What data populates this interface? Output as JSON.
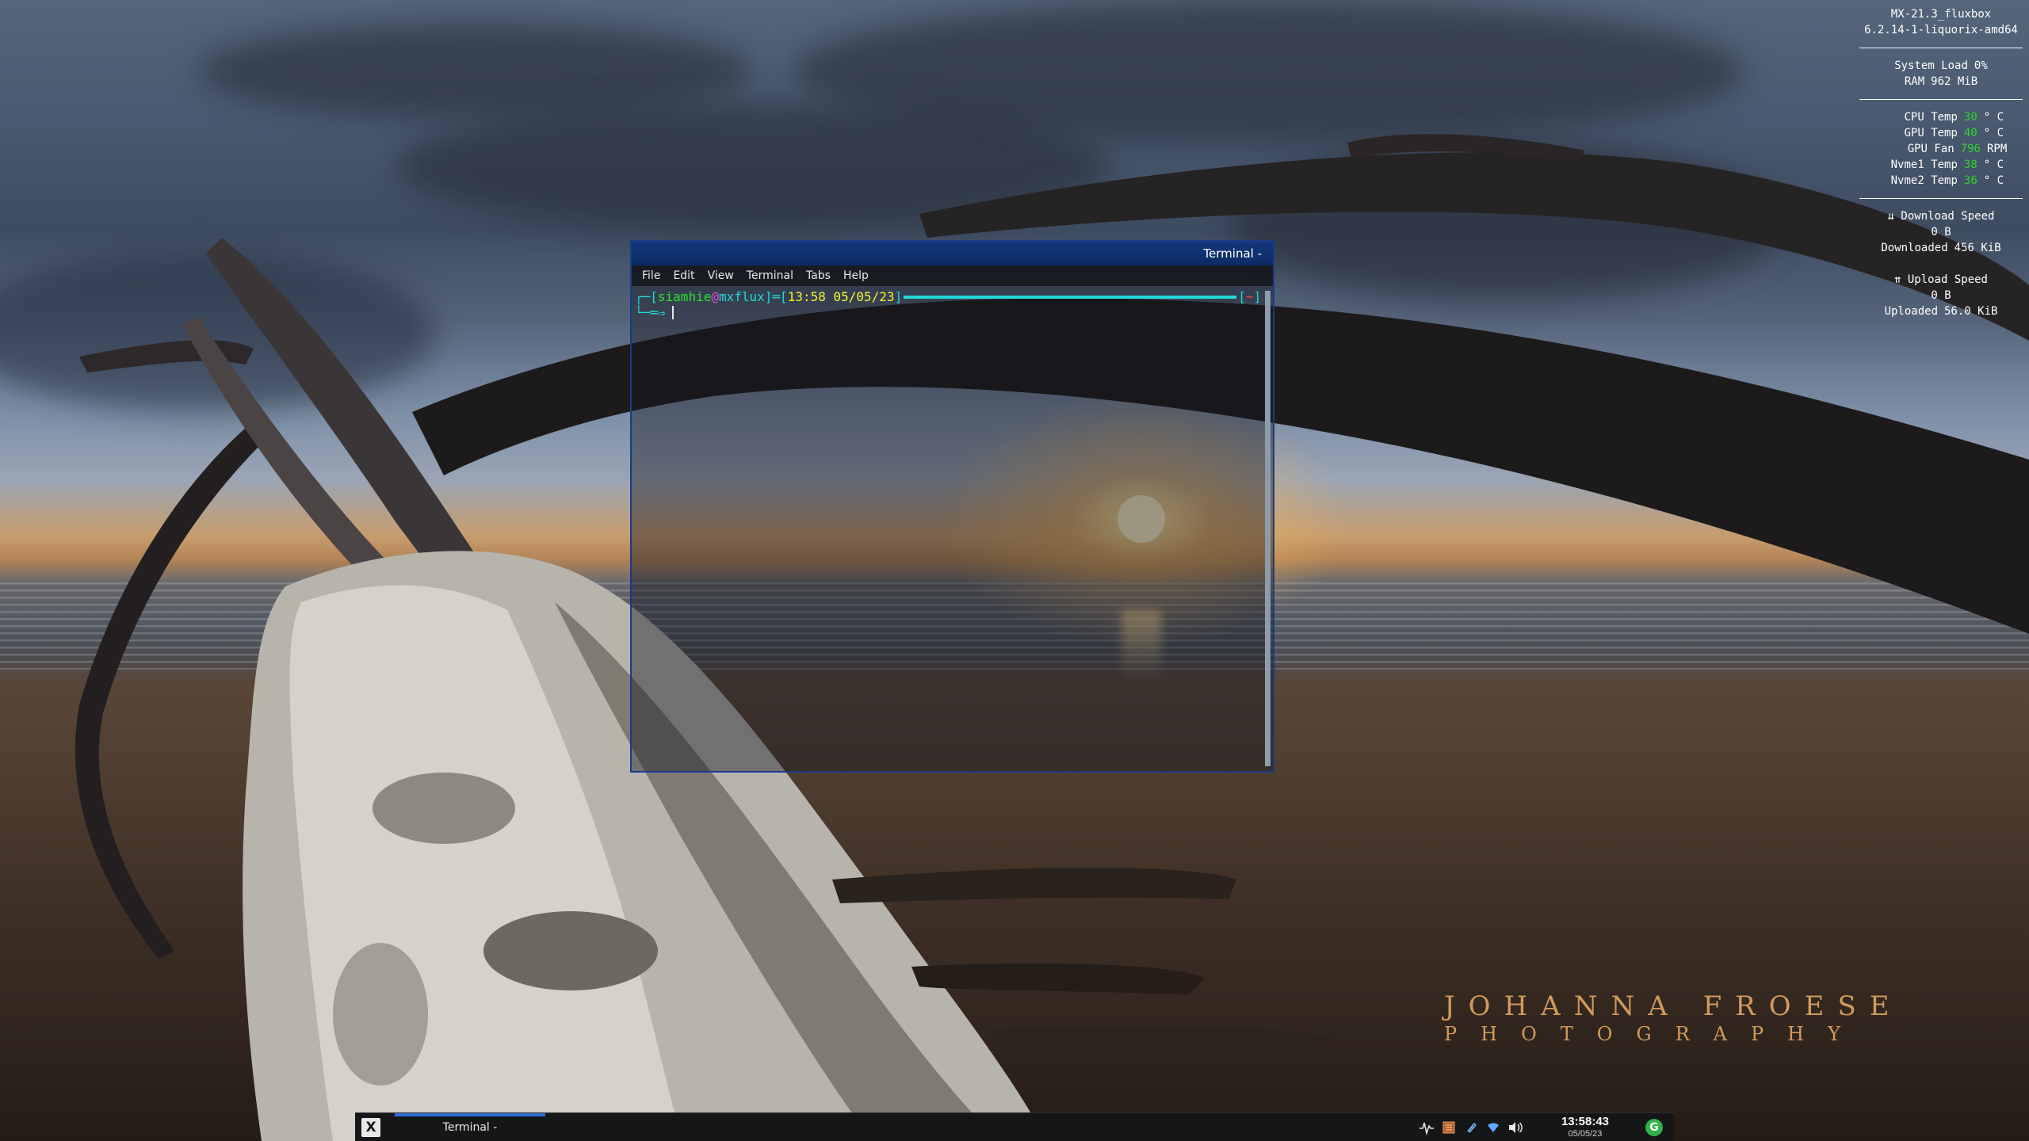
{
  "conky": {
    "hostname": "MX-21.3_fluxbox",
    "kernel": "6.2.14-1-liquorix-amd64",
    "system_load_label": "System Load",
    "system_load_value": "0%",
    "ram_label": "RAM",
    "ram_value": "962 MiB",
    "cpu_temp_label": "CPU Temp",
    "cpu_temp_value": "30",
    "cpu_temp_unit": "° C",
    "gpu_temp_label": "GPU Temp",
    "gpu_temp_value": "40",
    "gpu_temp_unit": "° C",
    "gpu_fan_label": "GPU Fan",
    "gpu_fan_value": "796",
    "gpu_fan_unit": "RPM",
    "nvme1_label": "Nvme1 Temp",
    "nvme1_value": "38",
    "nvme1_unit": "° C",
    "nvme2_label": "Nvme2 Temp",
    "nvme2_value": "36",
    "nvme2_unit": "° C",
    "download_speed_label": "⇊ Download Speed",
    "download_speed_value": "0 B",
    "downloaded_label": "Downloaded",
    "downloaded_value": "456 KiB",
    "upload_speed_label": "⇈ Upload Speed",
    "upload_speed_value": "0 B",
    "uploaded_label": "Uploaded",
    "uploaded_value": "56.0 KiB"
  },
  "terminal": {
    "title": "Terminal -",
    "menu": [
      "File",
      "Edit",
      "View",
      "Terminal",
      "Tabs",
      "Help"
    ],
    "prompt": {
      "user": "siamhie",
      "at": "@",
      "host": "mxflux",
      "time": "13:58",
      "date": "05/05/23",
      "dir": "~"
    }
  },
  "watermark": {
    "line1": "JOHANNA FROESE",
    "line2": "PHOTOGRAPHY"
  },
  "taskbar": {
    "start_glyph": "X",
    "task_terminal_label": "Terminal -",
    "clock_time": "13:58:43",
    "clock_date": "05/05/23",
    "updater_glyph": "G"
  },
  "colors": {
    "accent_blue": "#1a3a8a",
    "conky_green": "#2fd42f",
    "watermark": "#d19a5e"
  }
}
